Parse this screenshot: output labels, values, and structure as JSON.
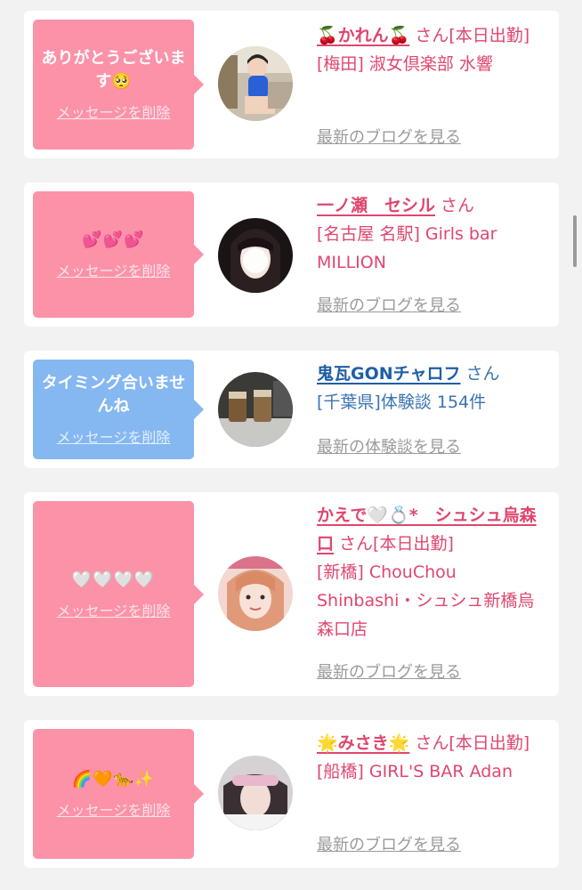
{
  "cards": [
    {
      "bubble_color": "#fb92a8",
      "message": "ありがとうございます🥺",
      "delete_label": "メッセージを削除",
      "name": "🍒かれん🍒",
      "honorific": "さん",
      "status": "[本日出勤]",
      "shop": "[梅田] 淑女倶楽部 水響",
      "blog_link": "最新のブログを見る"
    },
    {
      "bubble_color": "#fb92a8",
      "message": "💕💕💕",
      "delete_label": "メッセージを削除",
      "name": "一ノ瀬　セシル",
      "honorific": "さん",
      "status": "",
      "shop": "[名古屋 名駅] Girls bar MILLION",
      "blog_link": "最新のブログを見る"
    },
    {
      "bubble_color": "#85b7f1",
      "message": "タイミング合いませんね",
      "delete_label": "メッセージを削除",
      "name": "鬼瓦GONチャロフ",
      "honorific": "さん",
      "status": "",
      "shop": "[千葉県]体験談 154件",
      "blog_link": "最新の体験談を見る"
    },
    {
      "bubble_color": "#fb92a8",
      "message": "🤍🤍🤍🤍",
      "delete_label": "メッセージを削除",
      "name": "かえで🤍💍*　シュシュ烏森口",
      "honorific": "さん",
      "status": "[本日出勤]",
      "shop": "[新橋] ChouChou Shinbashi・シュシュ新橋烏森口店",
      "blog_link": "最新のブログを見る"
    },
    {
      "bubble_color": "#fb92a8",
      "message": "🌈🧡🐆✨",
      "delete_label": "メッセージを削除",
      "name": "🌟みさき🌟",
      "honorific": "さん",
      "status": "[本日出勤]",
      "shop": "[船橋] GIRL'S BAR Adan",
      "blog_link": "最新のブログを見る"
    }
  ]
}
